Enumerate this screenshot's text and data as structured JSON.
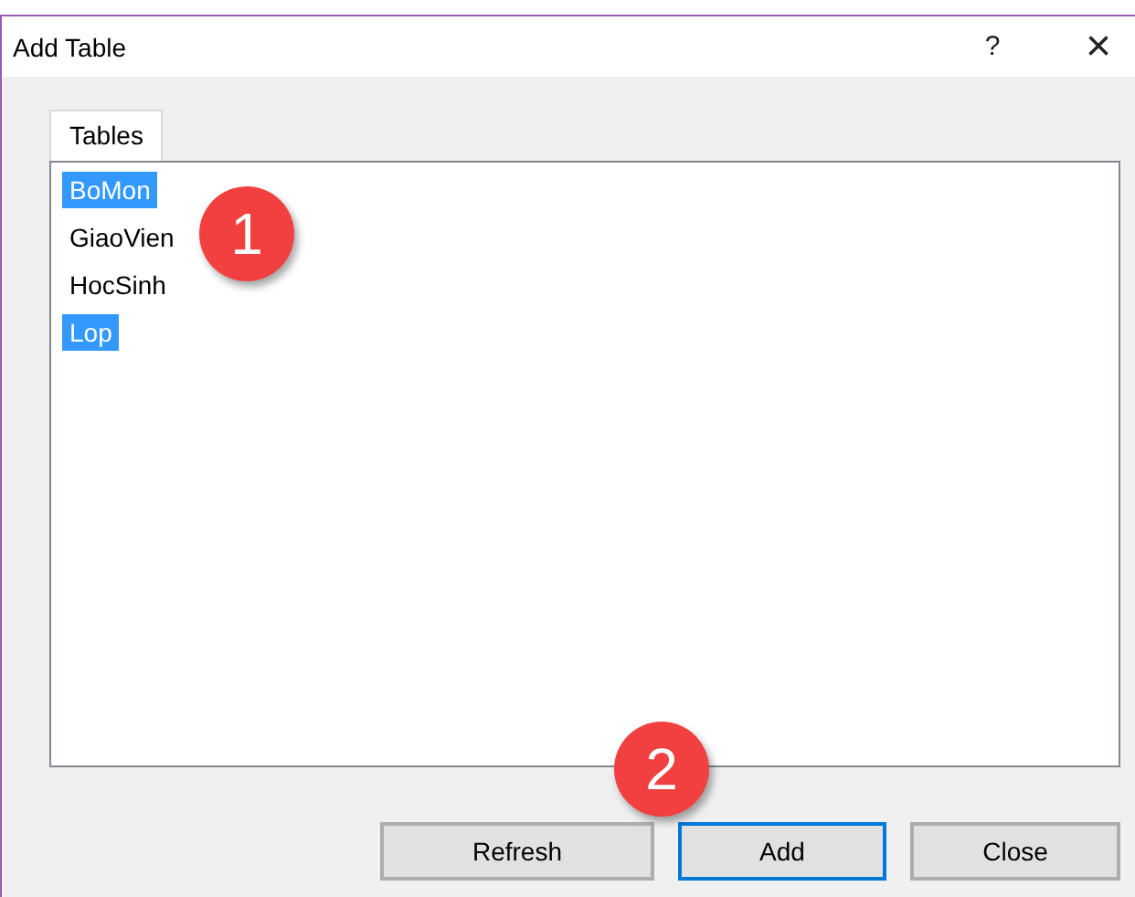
{
  "window": {
    "title": "Add Table",
    "help": "?",
    "close": "×"
  },
  "tabs": [
    {
      "label": "Tables",
      "selected": true
    }
  ],
  "items": [
    {
      "label": "BoMon",
      "selected": true
    },
    {
      "label": "GiaoVien",
      "selected": false
    },
    {
      "label": "HocSinh",
      "selected": false
    },
    {
      "label": "Lop",
      "selected": true
    }
  ],
  "buttons": [
    {
      "label": "Refresh",
      "focused": false
    },
    {
      "label": "Add",
      "focused": true
    },
    {
      "label": "Close",
      "focused": false
    }
  ],
  "callouts": [
    "1",
    "2"
  ]
}
